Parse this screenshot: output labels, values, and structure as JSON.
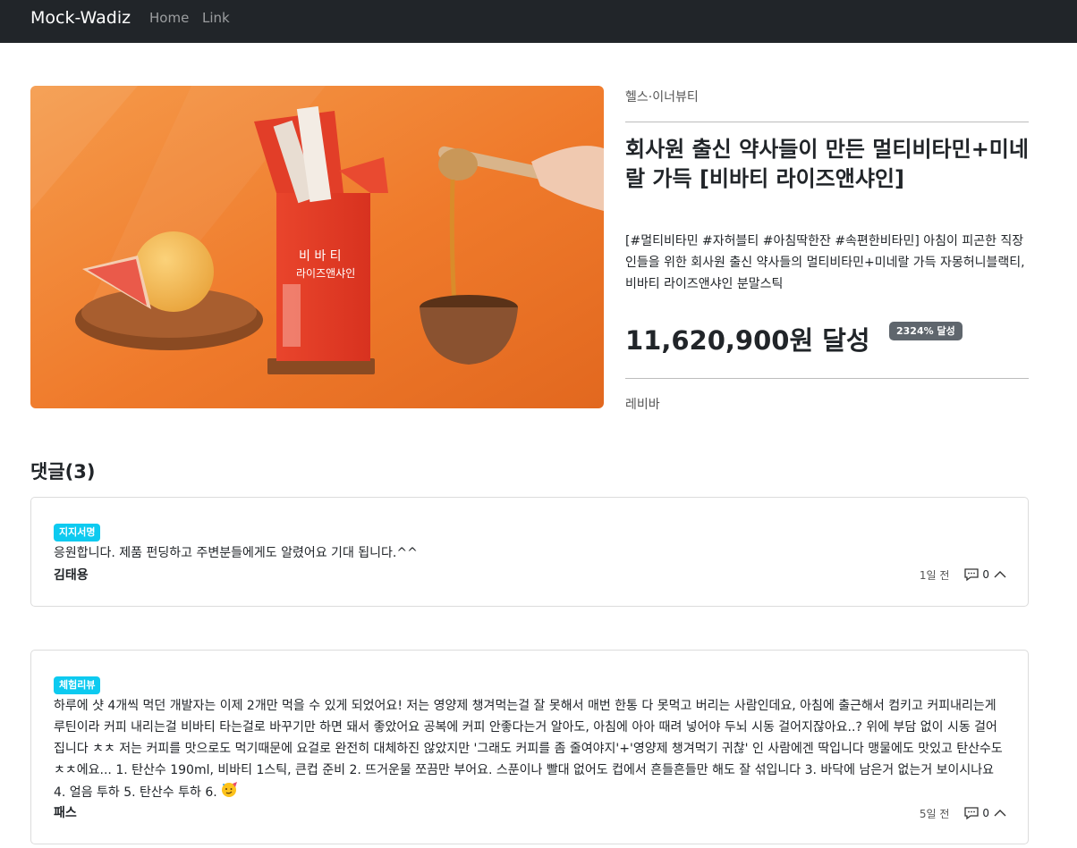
{
  "navbar": {
    "brand": "Mock-Wadiz",
    "links": [
      "Home",
      "Link"
    ]
  },
  "product": {
    "image_alt": "비바티 라이즈앤샤인 product photo",
    "image_text": [
      "비 바 티",
      "라이즈앤샤인"
    ],
    "category": "헬스·이너뷰티",
    "title": "회사원 출신 약사들이 만든 멀티비타민+미네랄 가득 [비바티 라이즈앤샤인]",
    "description": "[#멀티비타민 #자허블티 #아침딱한잔 #속편한비타민] 아침이 피곤한 직장인들을 위한 회사원 출신 약사들의 멀티비타민+미네랄 가득 자몽허니블랙티, 비바티 라이즈앤샤인 분말스틱",
    "amount": "11,620,900원 달성",
    "achievement_badge": "2324% 달성",
    "maker": "레비바"
  },
  "comments": {
    "heading": "댓글(3)",
    "items": [
      {
        "tag": "지지서명",
        "text": "응원합니다. 제품 펀딩하고 주변분들에게도 알렸어요 기대 됩니다.^^",
        "author": "김태용",
        "time": "1일 전",
        "reply_count": "0",
        "icons": [
          "comment-icon",
          "chevron-up-icon"
        ]
      },
      {
        "tag": "체험리뷰",
        "text": "하루에 샷 4개씩 먹던 개발자는 이제 2개만 먹을 수 있게 되었어요! 저는 영양제 챙겨먹는걸 잘 못해서 매번 한통 다 못먹고 버리는 사람인데요, 아침에 출근해서 컴키고 커피내리는게 루틴이라 커피 내리는걸 비바티 타는걸로 바꾸기만 하면 돼서 좋았어요 공복에 커피 안좋다는거 알아도, 아침에 아아 때려 넣어야 두뇌 시동 걸어지잖아요..? 위에 부담 없이 시동 걸어집니다 ㅊㅊ 저는 커피를 맛으로도 먹기때문에 요걸로 완전히 대체하진 않았지만 '그래도 커피를 좀 줄여야지'+'영양제 챙겨먹기 귀찮' 인 사람에겐 딱입니다 맹물에도 맛있고 탄산수도 ㅊㅊ에요... 1. 탄산수 190ml, 비바티 1스틱, 큰컵 준비 2. 뜨거운물 쪼끔만 부어요. 스푼이나 빨대 없어도 컵에서 흔들흔들만 해도 잘 섞입니다 3. 바닥에 남은거 없는거 보이시나요 4. 얼음 투하 5. 탄산수 투하 6.",
        "author": "패스",
        "time": "5일 전",
        "reply_count": "0",
        "icons": [
          "party-face-emoji-icon",
          "comment-icon",
          "chevron-up-icon"
        ]
      }
    ]
  },
  "colors": {
    "navbar_bg": "#212529",
    "badge_bg": "#5f666d",
    "tag_bg": "#0dcaf0",
    "hero_orange": "#f07a2e"
  }
}
